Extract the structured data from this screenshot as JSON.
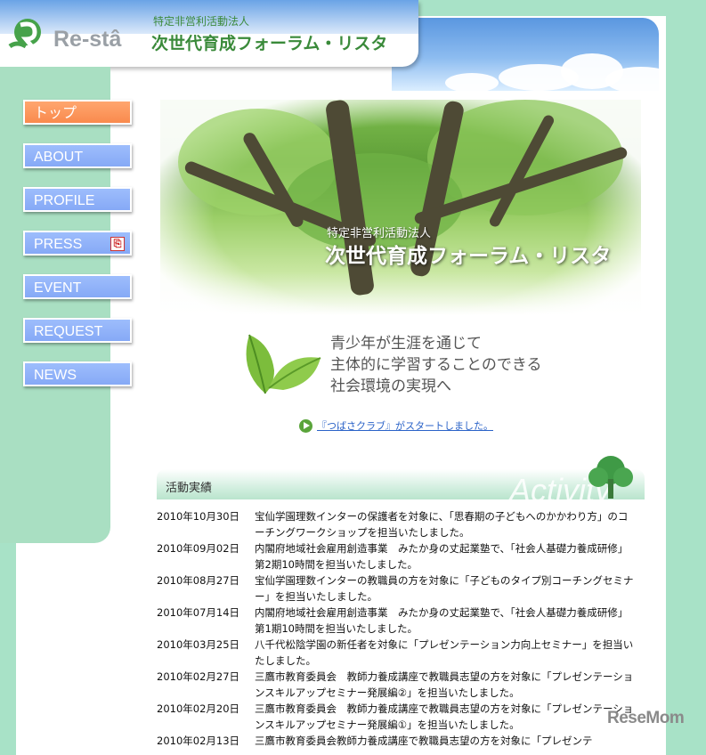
{
  "header": {
    "logo_text": "Re-stâ",
    "org_small": "特定非営利活動法人",
    "org_large": "次世代育成フォーラム・リスタ"
  },
  "nav": [
    {
      "label": "トップ",
      "active": true
    },
    {
      "label": "ABOUT"
    },
    {
      "label": "PROFILE"
    },
    {
      "label": "PRESS",
      "icon": "pdf-icon"
    },
    {
      "label": "EVENT"
    },
    {
      "label": "REQUEST"
    },
    {
      "label": "NEWS"
    }
  ],
  "hero": {
    "small": "特定非営利活動法人",
    "large": "次世代育成フォーラム・リスタ"
  },
  "slogan": {
    "line1": "青少年が生涯を通じて",
    "line2": "主体的に学習することのできる",
    "line3": "社会環境の実現へ"
  },
  "announcement": "『つばさクラブ』がスタートしました。",
  "activity": {
    "title": "活動実績",
    "watermark": "Activity",
    "items": [
      {
        "date": "2010年10月30日",
        "text": "宝仙学園理数インターの保護者を対象に、「思春期の子どもへのかかわり方」のコーチングワークショップを担当いたしました。"
      },
      {
        "date": "2010年09月02日",
        "text": "内閣府地域社会雇用創造事業　みたか身の丈起業塾で、「社会人基礎力養成研修」第2期10時間を担当いたしました。"
      },
      {
        "date": "2010年08月27日",
        "text": "宝仙学園理数インターの教職員の方を対象に「子どものタイプ別コーチングセミナー」を担当いたしました。"
      },
      {
        "date": "2010年07月14日",
        "text": "内閣府地域社会雇用創造事業　みたか身の丈起業塾で、「社会人基礎力養成研修」第1期10時間を担当いたしました。"
      },
      {
        "date": "2010年03月25日",
        "text": "八千代松陰学園の新任者を対象に「プレゼンテーション力向上セミナー」を担当いたしました。"
      },
      {
        "date": "2010年02月27日",
        "text": "三鷹市教育委員会　教師力養成講座で教職員志望の方を対象に「プレゼンテーションスキルアップセミナー発展編②」を担当いたしました。"
      },
      {
        "date": "2010年02月20日",
        "text": "三鷹市教育委員会　教師力養成講座で教職員志望の方を対象に「プレゼンテーションスキルアップセミナー発展編①」を担当いたしました。"
      },
      {
        "date": "2010年02月13日",
        "text": "三鷹市教育委員会教師力養成講座で教職員志望の方を対象に「プレゼンテ"
      }
    ]
  },
  "watermark_brand": "ReseMom"
}
